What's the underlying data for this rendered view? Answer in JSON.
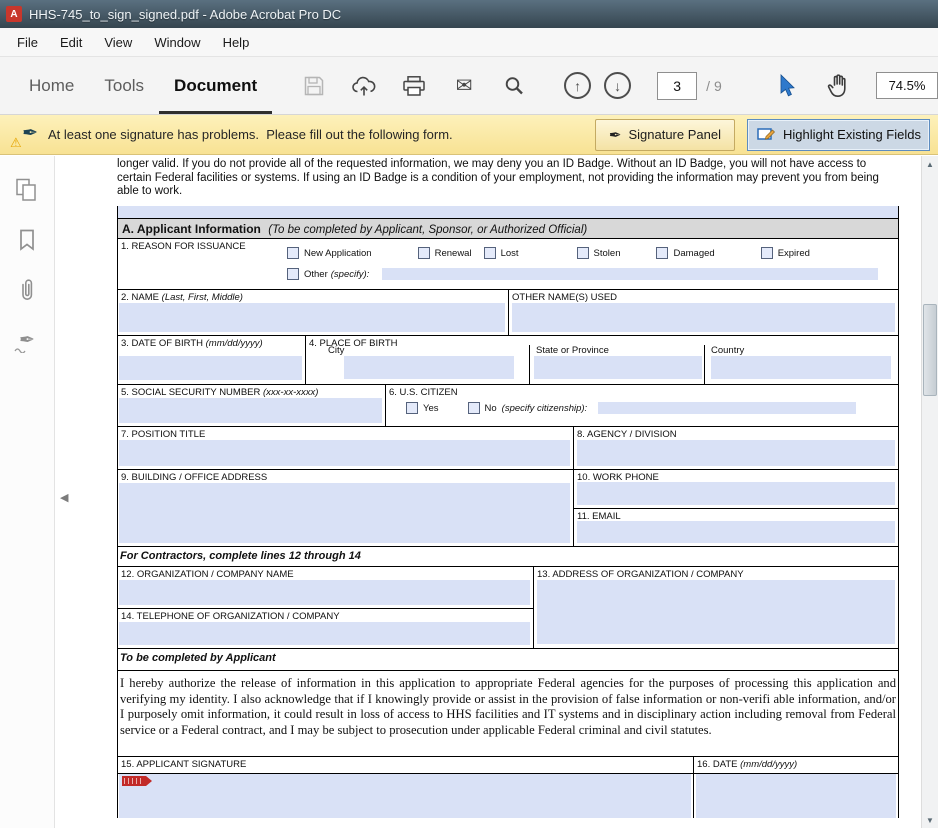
{
  "window": {
    "title": "HHS-745_to_sign_signed.pdf - Adobe Acrobat Pro DC"
  },
  "menubar": {
    "items": [
      "File",
      "Edit",
      "View",
      "Window",
      "Help"
    ]
  },
  "toolbar": {
    "tab_home": "Home",
    "tab_tools": "Tools",
    "tab_document": "Document",
    "page_current": "3",
    "page_total": "/ 9",
    "zoom_value": "74.5%"
  },
  "message_bar": {
    "text": "At least one signature has problems.  Please fill out the following form.",
    "signature_panel_label": "Signature Panel",
    "highlight_fields_label": "Highlight Existing Fields"
  },
  "icons": {
    "acrobat": "A",
    "pen": "✒",
    "warning": "⚠",
    "envelope": "✉",
    "prev_page": "↑",
    "next_page": "↓",
    "scroll_up": "▲",
    "scroll_down": "▼",
    "collapse_left": "◀"
  },
  "form": {
    "intro": "longer valid. If you do not provide all of the requested information, we may deny you an ID Badge. Without an ID Badge, you will not have access to certain Federal facilities or systems. If using an ID Badge is a condition of your employment, not providing the information may prevent you from being able to work.",
    "section_a": {
      "title": "A. Applicant Information",
      "subtitle": "(To be completed by Applicant, Sponsor, or Authorized Official)"
    },
    "q1": {
      "label": "1. REASON FOR ISSUANCE",
      "options": [
        "New Application",
        "Renewal",
        "Lost",
        "Stolen",
        "Damaged",
        "Expired"
      ],
      "other_label": "Other",
      "other_hint": "(specify):"
    },
    "q2": {
      "label": "2. NAME",
      "hint": "(Last, First, Middle)"
    },
    "other_names": {
      "label": "OTHER NAME(S) USED"
    },
    "q3": {
      "label": "3. DATE OF BIRTH",
      "hint": "(mm/dd/yyyy)"
    },
    "q4": {
      "label": "4. PLACE OF BIRTH",
      "city": "City",
      "state": "State or Province",
      "country": "Country"
    },
    "q5": {
      "label": "5. SOCIAL SECURITY NUMBER",
      "hint": "(xxx-xx-xxxx)"
    },
    "q6": {
      "label": "6. U.S. CITIZEN",
      "yes": "Yes",
      "no": "No",
      "no_hint": "(specify citizenship):"
    },
    "q7": {
      "label": "7. POSITION TITLE"
    },
    "q8": {
      "label": "8. AGENCY / DIVISION"
    },
    "q9": {
      "label": "9. BUILDING / OFFICE ADDRESS"
    },
    "q10": {
      "label": "10. WORK PHONE"
    },
    "q11": {
      "label": "11. EMAIL"
    },
    "contractors_note": "For Contractors, complete lines 12 through 14",
    "q12": {
      "label": "12. ORGANIZATION / COMPANY NAME"
    },
    "q13": {
      "label": "13. ADDRESS OF ORGANIZATION / COMPANY"
    },
    "q14": {
      "label": "14. TELEPHONE OF ORGANIZATION / COMPANY"
    },
    "applicant_note": "To be completed by Applicant",
    "authorization": "I hereby authorize the release of information in this application to appropriate Federal agencies for the purposes of processing this application and verifying my identity. I also acknowledge that if I knowingly provide or assist in the provision of false information or non-verifi able information, and/or I purposely omit information, it could result in loss of access to HHS facilities and IT systems and in disciplinary action including removal from Federal service or a Federal contract, and I may be subject to prosecution under applicable Federal criminal and civil statutes.",
    "q15": {
      "label": "15. APPLICANT SIGNATURE"
    },
    "q16": {
      "label": "16. DATE",
      "hint": "(mm/dd/yyyy)"
    }
  },
  "colors": {
    "field_highlight": "#d9e1f6",
    "message_bar_bg": "#f9e7a4",
    "accent_blue": "#2e79cc"
  }
}
